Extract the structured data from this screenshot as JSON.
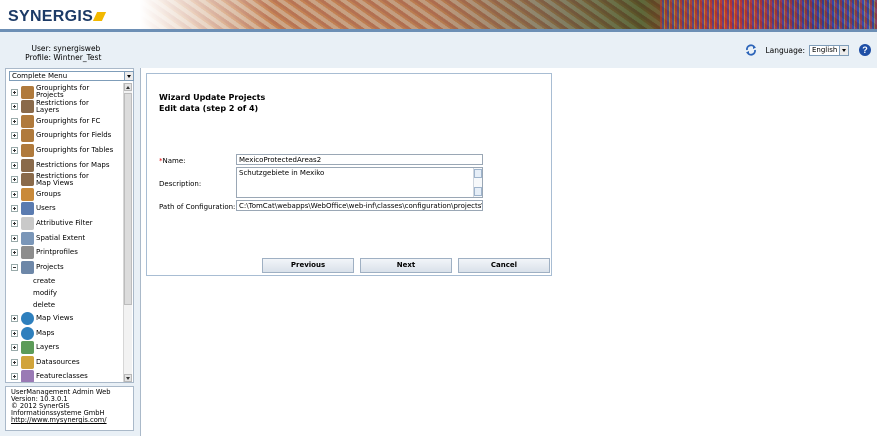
{
  "app": {
    "logo": "SYNERGIS",
    "brand_color": "#1c3a66",
    "accent_color": "#f2b800"
  },
  "user": {
    "user_label": "User:",
    "user_value": "synergisweb",
    "profile_label": "Profile:",
    "profile_value": "Wintner_Test"
  },
  "topbar": {
    "language_label": "Language:",
    "language_value": "English",
    "refresh_icon": "refresh-icon",
    "help_icon": "help-icon",
    "help_glyph": "?"
  },
  "sidebar": {
    "menu_select_value": "Complete Menu",
    "items": [
      {
        "label": "Grouprights for Projects",
        "icon": "group-rights-icon",
        "expanded": false
      },
      {
        "label": "Restrictions for Layers",
        "icon": "restriction-icon",
        "expanded": false
      },
      {
        "label": "Grouprights for FC",
        "icon": "group-rights-icon",
        "expanded": false
      },
      {
        "label": "Grouprights for Fields",
        "icon": "group-rights-icon",
        "expanded": false
      },
      {
        "label": "Grouprights for Tables",
        "icon": "group-rights-icon",
        "expanded": false
      },
      {
        "label": "Restrictions for Maps",
        "icon": "restriction-icon",
        "expanded": false
      },
      {
        "label": "Restrictions for Map Views",
        "icon": "restriction-icon",
        "expanded": false
      },
      {
        "label": "Groups",
        "icon": "groups-icon",
        "expanded": false
      },
      {
        "label": "Users",
        "icon": "users-icon",
        "expanded": false
      },
      {
        "label": "Attributive Filter",
        "icon": "filter-icon",
        "expanded": false
      },
      {
        "label": "Spatial Extent",
        "icon": "extent-icon",
        "expanded": false
      },
      {
        "label": "Printprofiles",
        "icon": "printer-icon",
        "expanded": false
      },
      {
        "label": "Projects",
        "icon": "projects-icon",
        "expanded": true
      },
      {
        "label": "Map Views",
        "icon": "globe-icon",
        "expanded": false
      },
      {
        "label": "Maps",
        "icon": "globe-icon",
        "expanded": false
      },
      {
        "label": "Layers",
        "icon": "layers-icon",
        "expanded": false
      },
      {
        "label": "Datasources",
        "icon": "database-icon",
        "expanded": false
      },
      {
        "label": "Featureclasses",
        "icon": "featureclass-icon",
        "expanded": false
      }
    ],
    "project_subitems": [
      "create",
      "modify",
      "delete"
    ]
  },
  "footer": {
    "line1": "UserManagement Admin Web",
    "line2": "Version: 10.3.0.1",
    "line3": "© 2012 SynerGIS",
    "line4": "Informationssysteme GmbH",
    "link": "http://www.mysynergis.com/"
  },
  "wizard": {
    "title": "Wizard Update Projects",
    "subtitle": "Edit data (step 2 of 4)",
    "required_mark": "*",
    "name_label": "Name:",
    "name_value": "MexicoProtectedAreas2",
    "description_label": "Description:",
    "description_value": "Schutzgebiete in Mexiko",
    "path_label": "Path of Configuration:",
    "path_value": "C:\\TomCat\\webapps\\WebOffice\\web-inf\\classes\\configuration\\projects\\",
    "previous_button": "Previous",
    "next_button": "Next",
    "cancel_button": "Cancel"
  }
}
